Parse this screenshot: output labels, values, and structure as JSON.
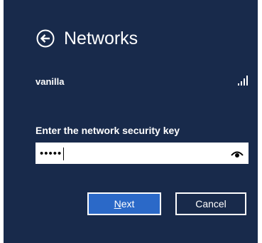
{
  "header": {
    "title": "Networks",
    "back_icon": "back-arrow-circle-icon"
  },
  "network": {
    "name": "vanilla",
    "signal_icon": "wifi-signal-bars-icon",
    "signal_bars": 4
  },
  "security_key": {
    "label": "Enter the network security key",
    "masked_value": "•••••",
    "reveal_icon": "show-password-eye-icon"
  },
  "buttons": {
    "next_mnemonic": "N",
    "next_rest": "ext",
    "cancel": "Cancel"
  },
  "colors": {
    "background": "#182a4b",
    "accent": "#2b69c8",
    "text": "#ffffff"
  }
}
